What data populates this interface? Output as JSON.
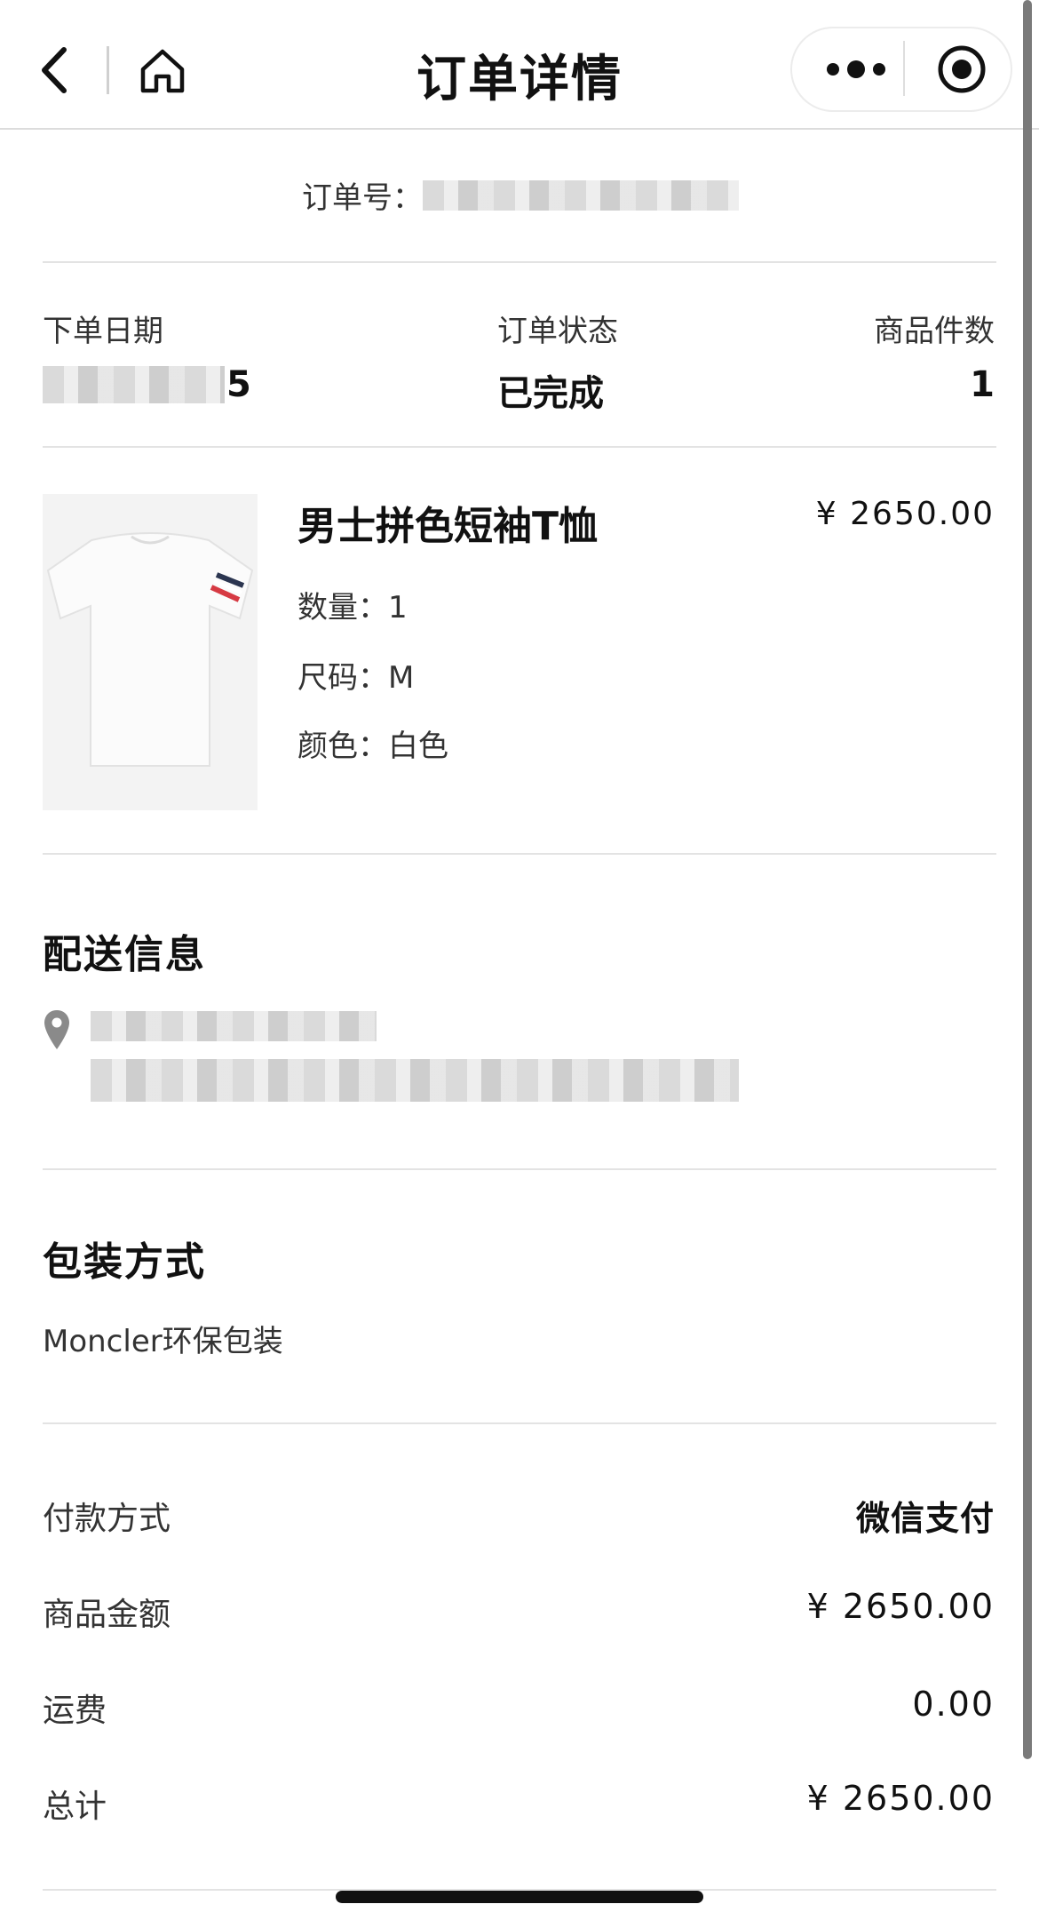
{
  "nav": {
    "title": "订单详情",
    "icons": {
      "back": "chevron-left-icon",
      "home": "home-icon",
      "more": "more-dots-icon",
      "close": "target-circle-icon"
    }
  },
  "order": {
    "number_label": "订单号："
  },
  "meta": {
    "date_label": "下单日期",
    "date_value_visible": "5",
    "status_label": "订单状态",
    "status_value": "已完成",
    "count_label": "商品件数",
    "count_value": "1"
  },
  "product": {
    "name": "男士拼色短袖T恤",
    "price": "¥ 2650.00",
    "quantity": "数量：1",
    "size": "尺码：M",
    "color": "颜色：白色"
  },
  "shipping": {
    "title": "配送信息",
    "icon": "location-pin-icon"
  },
  "packaging": {
    "title": "包装方式",
    "value": "Moncler环保包装"
  },
  "payment": {
    "method_label": "付款方式",
    "method_value": "微信支付",
    "subtotal_label": "商品金额",
    "subtotal_value": "¥ 2650.00",
    "shipping_label": "运费",
    "shipping_value": "0.00",
    "total_label": "总计",
    "total_value": "¥ 2650.00"
  },
  "colors": {
    "text": "#1a1a1a",
    "divider": "#e3e3e3",
    "flag_navy": "#2b3550",
    "flag_red": "#d63a43"
  }
}
